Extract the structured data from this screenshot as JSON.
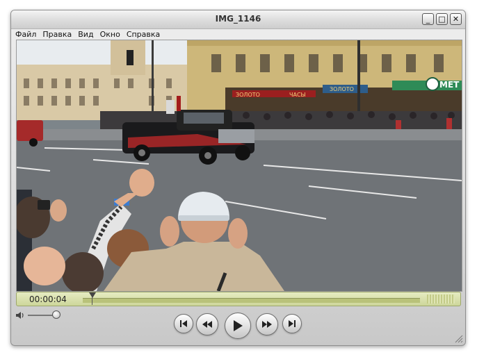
{
  "window": {
    "title": "IMG_1146",
    "buttons": {
      "minimize": "_",
      "maximize": "□",
      "close": "✕"
    }
  },
  "menu": [
    "Файл",
    "Правка",
    "Вид",
    "Окно",
    "Справка"
  ],
  "player": {
    "timecode": "00:00:04",
    "progress": 0.02,
    "volume": 0.85
  },
  "video_signs": {
    "store_left": "ЗОЛОТО",
    "store_right": "ЧАСЫ",
    "store_center": "ЗОЛОТО",
    "metro": "МЕТ"
  },
  "colors": {
    "timebar": "#d8df9f",
    "accent_red": "#c9302c",
    "metro_green": "#2e8b57"
  },
  "icons": [
    "minimize-icon",
    "maximize-icon",
    "close-icon",
    "speaker-icon",
    "skip-back-icon",
    "rewind-icon",
    "play-icon",
    "fast-forward-icon",
    "skip-forward-icon",
    "resize-grip-icon"
  ]
}
